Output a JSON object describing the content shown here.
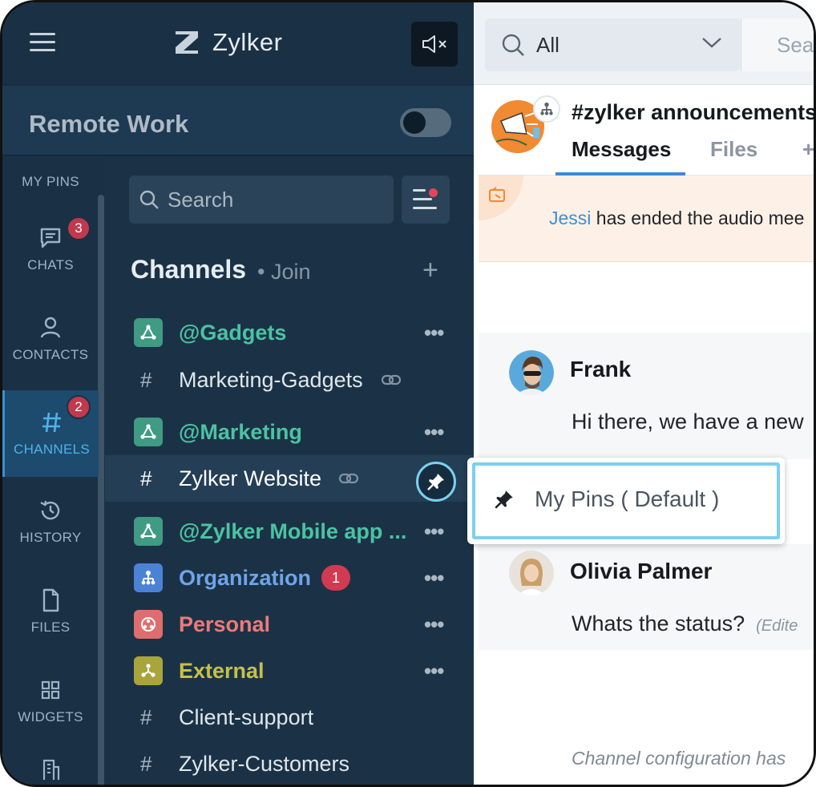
{
  "app": {
    "brand": "Zylker",
    "status_title": "Remote Work",
    "status_toggle_on": false
  },
  "nav": {
    "my_pins": "MY PINS",
    "chats": "CHATS",
    "chats_badge": "3",
    "contacts": "CONTACTS",
    "channels": "CHANNELS",
    "channels_badge": "2",
    "history": "HISTORY",
    "files": "FILES",
    "widgets": "WIDGETS"
  },
  "list": {
    "search_placeholder": "Search",
    "header": "Channels",
    "join": "• Join",
    "plus": "+",
    "items": [
      {
        "name": "@Gadgets",
        "kind": "team",
        "color": "#3f9b84",
        "more": "•••"
      },
      {
        "name": "Marketing-Gadgets",
        "kind": "hash",
        "more": ""
      },
      {
        "name": "@Marketing",
        "kind": "team",
        "color": "#3f9b84",
        "more": "•••"
      },
      {
        "name": "Zylker Website",
        "kind": "hash",
        "more": ""
      },
      {
        "name": "@Zylker Mobile app ...",
        "kind": "team",
        "color": "#3f9b84",
        "more": "•••"
      },
      {
        "name": "Organization",
        "kind": "org",
        "color": "#4c82d6",
        "more": "•••",
        "count": "1"
      },
      {
        "name": "Personal",
        "kind": "personal",
        "color": "#e06d6d",
        "more": "•••"
      },
      {
        "name": "External",
        "kind": "external",
        "color": "#a9a43c",
        "more": "•••"
      },
      {
        "name": "Client-support",
        "kind": "hash",
        "more": ""
      },
      {
        "name": "Zylker-Customers",
        "kind": "hash",
        "more": ""
      }
    ]
  },
  "right": {
    "scope": "All",
    "search_placeholder": "Sea",
    "channel_title": "#zylker announcements",
    "tabs": [
      "Messages",
      "Files",
      "+"
    ],
    "notice_who": "Jessi",
    "notice_text": " has ended the audio mee",
    "messages": [
      {
        "name": "Frank",
        "text": "Hi there, we have a new",
        "edited": ""
      },
      {
        "name": "Olivia Palmer",
        "text": "Whats the status?",
        "edited": "(Edite"
      }
    ],
    "config_note": "Channel configuration has"
  },
  "popover": {
    "item": "My Pins ( Default )"
  },
  "colors": {
    "sidebar_bg": "#1b3246",
    "accent": "#4fb2ea",
    "badge": "#c0394c",
    "pin_highlight": "#7bd0ee",
    "link": "#3c8fd6"
  }
}
